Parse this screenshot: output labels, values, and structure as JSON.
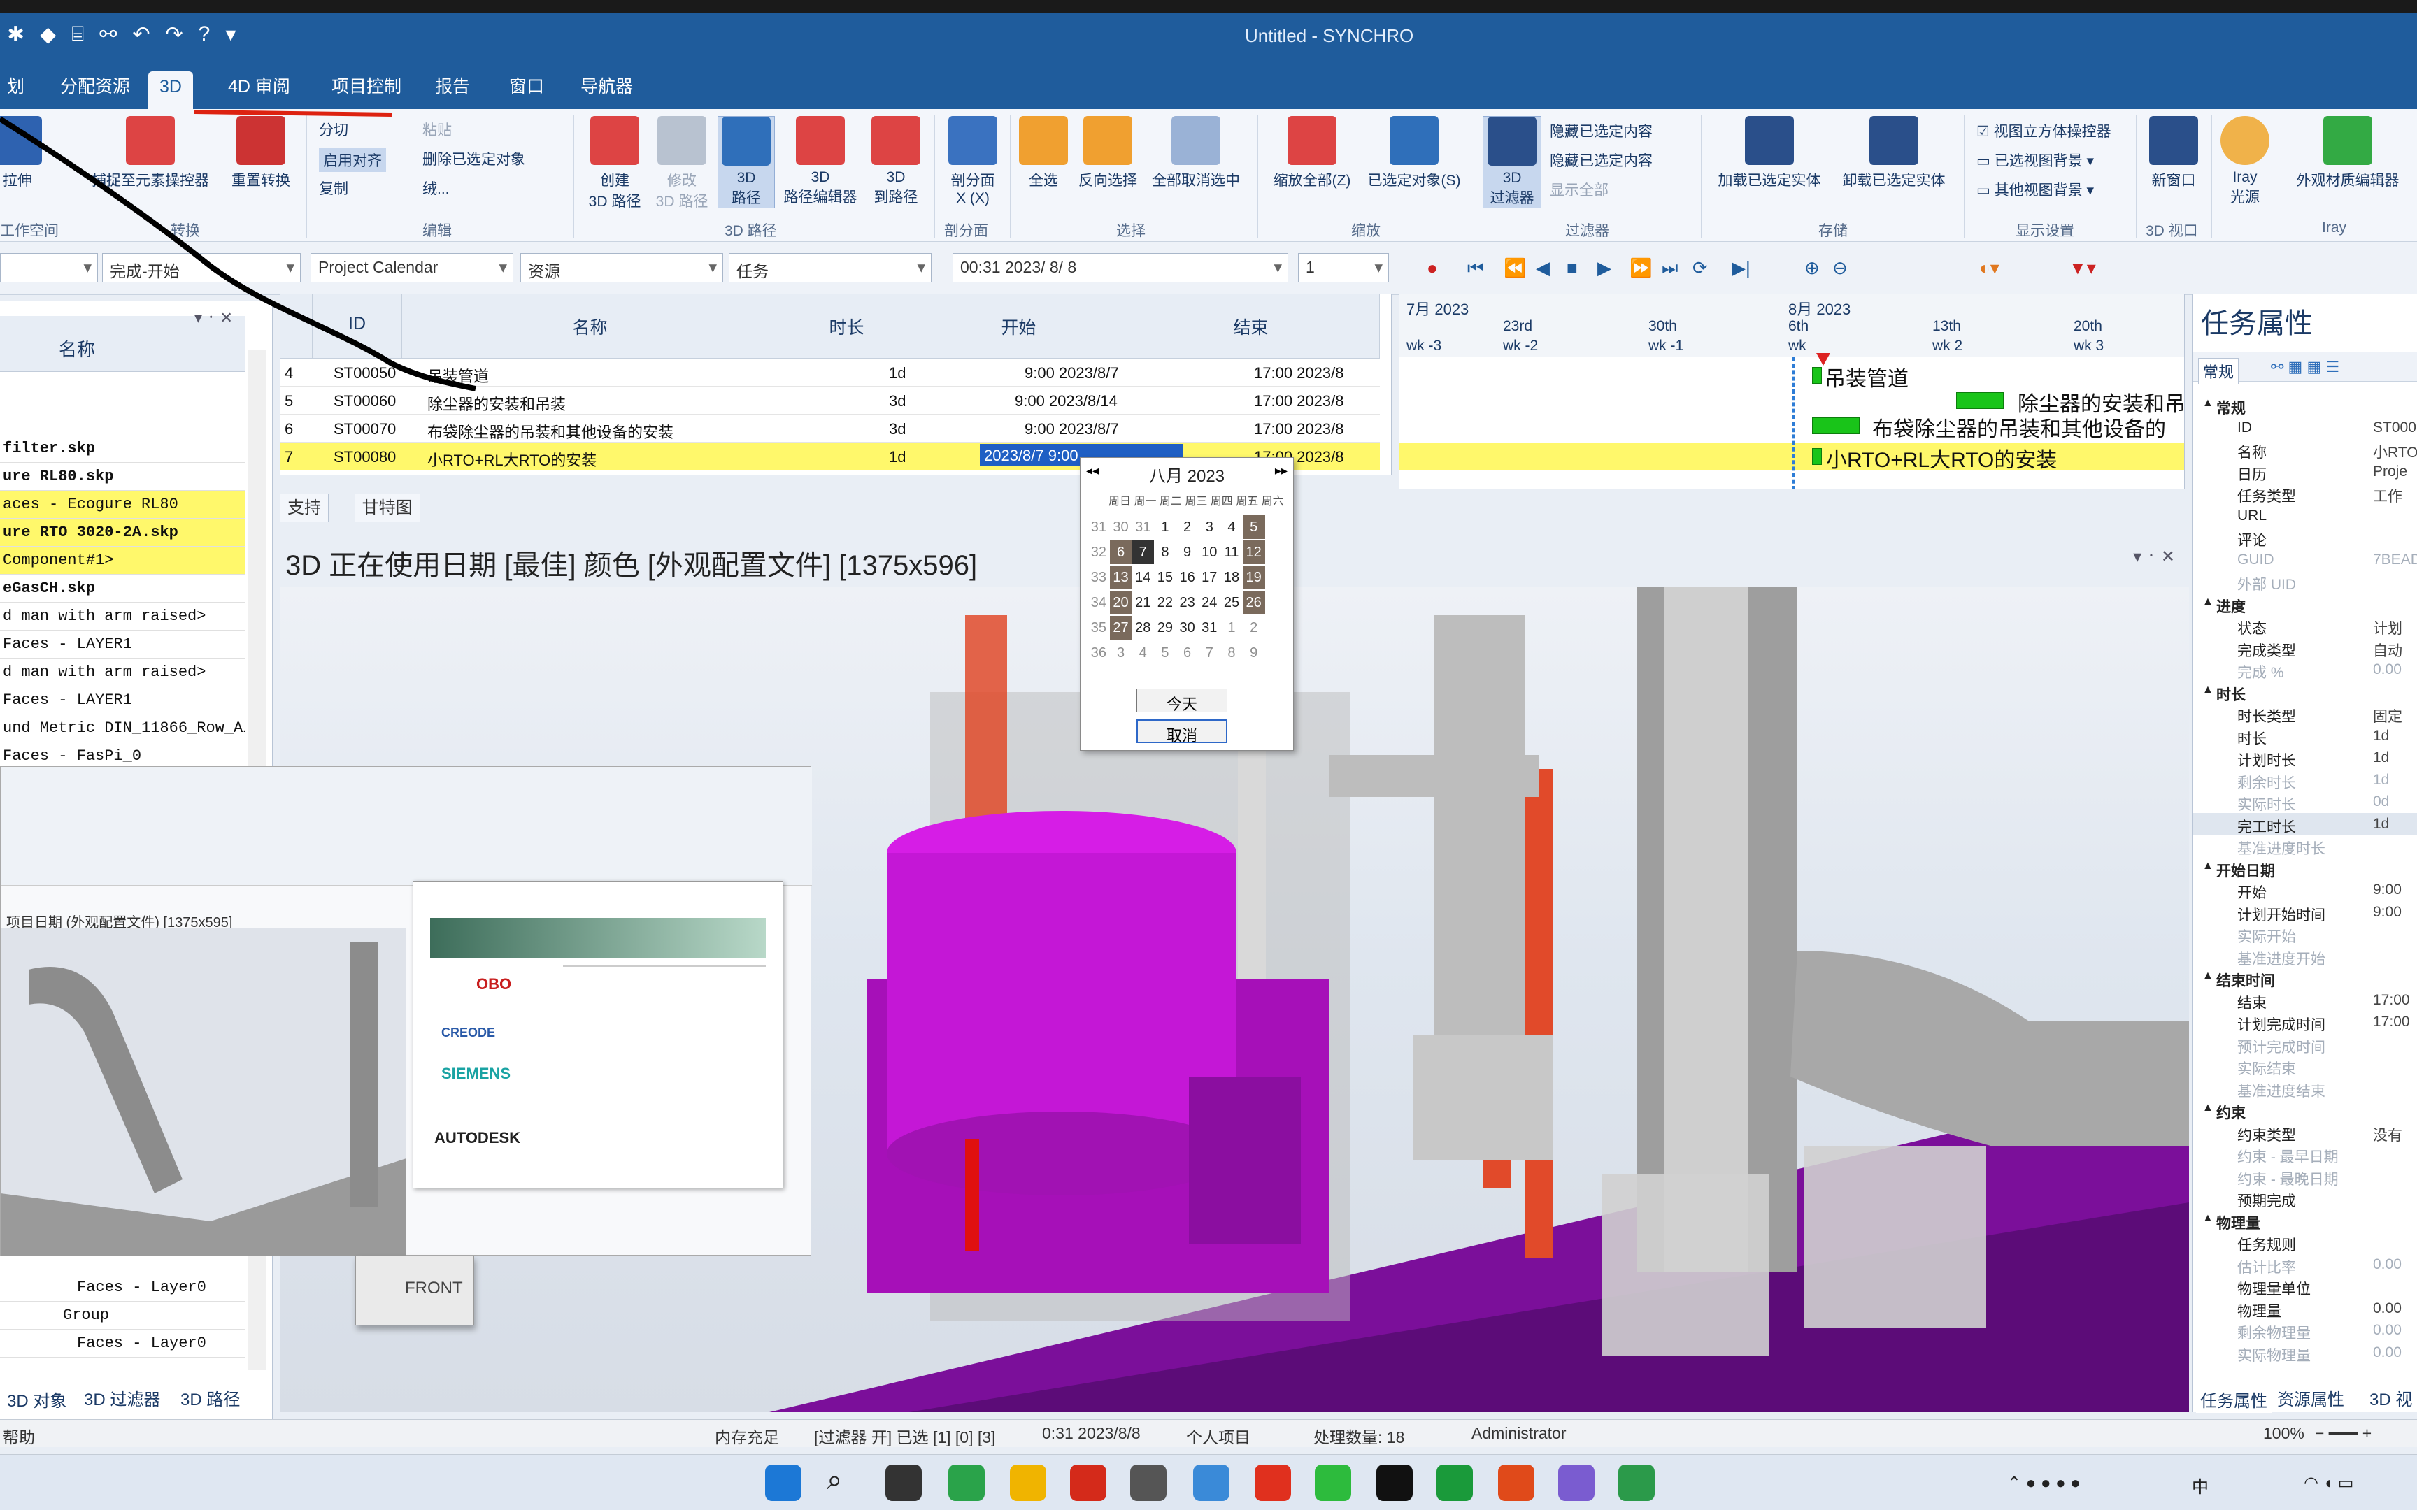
{
  "window": {
    "title": "Untitled - SYNCHRO"
  },
  "menu": {
    "tabs": [
      "划",
      "分配资源",
      "3D",
      "4D 审阅",
      "项目控制",
      "报告",
      "窗口",
      "导航器"
    ]
  },
  "ribbon": {
    "groups": {
      "work_space": "工作空间",
      "transform": "转换",
      "edit": "编辑",
      "path3d": "3D 路径",
      "section": "剖分面",
      "select": "选择",
      "zoom": "缩放",
      "filter": "过滤器",
      "storage": "存储",
      "display": "显示设置",
      "view3d": "3D 视口",
      "iray": "Iray"
    },
    "buttons": {
      "stretch": "拉伸",
      "capture_element": "捕捉至元素操控器",
      "reset_transform": "重置转换",
      "split": "分切",
      "enable_align": "启用对齐",
      "copy": "复制",
      "paste": "粘贴",
      "remove_selected": "删除已选定对象",
      "more": "绒...",
      "create_path": "创建\n3D 路径",
      "modify_path": "修改\n3D 路径",
      "path_3d": "3D\n路径",
      "path_editor": "3D\n路径编辑器",
      "path_to": "3D\n到路径",
      "section_plane": "剖分面\nX (X)",
      "select_all": "全选",
      "invert_select": "反向选择",
      "deselect_all": "全部取消选中",
      "zoom_all": "缩放全部(Z)",
      "zoom_selected": "已选定对象(S)",
      "filter_3d": "3D\n过滤器",
      "hide_selected": "隐藏已选定内容",
      "hide_unselected": "隐藏已选定内容",
      "show_all": "显示全部",
      "load_selected": "加载已选定实体",
      "unload_selected": "卸载已选定实体",
      "view_cube": "视图立方体操控器",
      "selected_bg": "已选视图背景",
      "other_bg": "其他视图背景",
      "new_window": "新窗口",
      "iray_light": "Iray\n光源",
      "appearance_profile": "外观材质编辑器"
    }
  },
  "toolbar2": {
    "combo1": "",
    "combo2": "完成-开始",
    "combo3": "Project Calendar",
    "combo4": "资源",
    "combo5": "任务",
    "date": "00:31 2023/ 8/ 8",
    "spin": "1"
  },
  "left_panel": {
    "header": "名称",
    "rows": [
      "filter.skp",
      "ure RL80.skp",
      "aces - Ecogure RL80",
      "ure RTO 3020-2A.skp",
      "Component#1>",
      "eGasCH.skp",
      "d man with arm raised>",
      "Faces - LAYER1",
      "d man with arm raised>",
      "Faces - LAYER1",
      "und Metric DIN_11866_Row_A/C",
      "Faces - FasPi_0"
    ],
    "tree_rows": [
      "Faces - Layer0",
      "Group",
      "Faces - Layer0"
    ],
    "bottom_tabs": [
      "3D 对象",
      "3D 过滤器",
      "3D 路径"
    ]
  },
  "grid": {
    "headers": {
      "id": "ID",
      "name": "名称",
      "duration": "时长",
      "start": "开始",
      "finish": "结束"
    },
    "rows": [
      {
        "n": "4",
        "id": "ST00050",
        "name": "吊装管道",
        "duration": "1d",
        "start": "9:00 2023/8/7",
        "finish": "17:00 2023/8"
      },
      {
        "n": "5",
        "id": "ST00060",
        "name": "除尘器的安装和吊装",
        "duration": "3d",
        "start": "9:00 2023/8/14",
        "finish": "17:00 2023/8"
      },
      {
        "n": "6",
        "id": "ST00070",
        "name": "布袋除尘器的吊装和其他设备的安装",
        "duration": "3d",
        "start": "9:00 2023/8/7",
        "finish": "17:00 2023/8"
      },
      {
        "n": "7",
        "id": "ST00080",
        "name": "小RTO+RL大RTO的安装",
        "duration": "1d",
        "start": "2023/8/7  9:00",
        "finish": "17:00 2023/8"
      }
    ],
    "tabs": [
      "支持",
      "甘特图"
    ]
  },
  "gantt": {
    "months": [
      "7月 2023",
      "8月 2023"
    ],
    "days": [
      "23rd",
      "30th",
      "6th",
      "13th",
      "20th"
    ],
    "weeks": [
      "wk -3",
      "wk -2",
      "wk -1",
      "wk",
      "wk 2",
      "wk 3"
    ],
    "labels": [
      "吊装管道",
      "除尘器的安装和吊",
      "布袋除尘器的吊装和其他设备的",
      "小RTO+RL大RTO的安装"
    ]
  },
  "calendar": {
    "title": "八月 2023",
    "weekday_header": "周日 周一 周二 周三 周四 周五 周六",
    "weeks": [
      {
        "wk": "31",
        "days": [
          "30",
          "31",
          "1",
          "2",
          "3",
          "4",
          "5"
        ]
      },
      {
        "wk": "32",
        "days": [
          "6",
          "7",
          "8",
          "9",
          "10",
          "11",
          "12"
        ]
      },
      {
        "wk": "33",
        "days": [
          "13",
          "14",
          "15",
          "16",
          "17",
          "18",
          "19"
        ]
      },
      {
        "wk": "34",
        "days": [
          "20",
          "21",
          "22",
          "23",
          "24",
          "25",
          "26"
        ]
      },
      {
        "wk": "35",
        "days": [
          "27",
          "28",
          "29",
          "30",
          "31",
          "1",
          "2"
        ]
      },
      {
        "wk": "36",
        "days": [
          "3",
          "4",
          "5",
          "6",
          "7",
          "8",
          "9"
        ]
      }
    ],
    "today": "今天",
    "cancel": "取消"
  },
  "view3d": {
    "header": "3D 正在使用日期 [最佳] 颜色 [外观配置文件]  [1375x596]",
    "cube_label": "FRONT",
    "brands": [
      "OBO",
      "CREODE",
      "SIEMENS",
      "AUTODESK"
    ],
    "overlay_title": "项目日期 (外观配置文件) [1375x595]"
  },
  "right_panel": {
    "title": "任务属性",
    "tab": "常规",
    "rows": [
      {
        "t": "cat",
        "k": "常规",
        "v": ""
      },
      {
        "t": "",
        "k": "ID",
        "v": "ST000"
      },
      {
        "t": "",
        "k": "名称",
        "v": "小RTO"
      },
      {
        "t": "",
        "k": "日历",
        "v": "Proje"
      },
      {
        "t": "",
        "k": "任务类型",
        "v": "工作"
      },
      {
        "t": "",
        "k": "URL",
        "v": ""
      },
      {
        "t": "",
        "k": "评论",
        "v": ""
      },
      {
        "t": "dim",
        "k": "GUID",
        "v": "7BEAD"
      },
      {
        "t": "dim",
        "k": "外部 UID",
        "v": ""
      },
      {
        "t": "cat",
        "k": "进度",
        "v": ""
      },
      {
        "t": "",
        "k": "状态",
        "v": "计划"
      },
      {
        "t": "",
        "k": "完成类型",
        "v": "自动"
      },
      {
        "t": "dim",
        "k": "完成 %",
        "v": "0.00"
      },
      {
        "t": "cat",
        "k": "时长",
        "v": ""
      },
      {
        "t": "",
        "k": "时长类型",
        "v": "固定"
      },
      {
        "t": "",
        "k": "时长",
        "v": "1d"
      },
      {
        "t": "",
        "k": "计划时长",
        "v": "1d"
      },
      {
        "t": "dim",
        "k": "剩余时长",
        "v": "1d"
      },
      {
        "t": "dim",
        "k": "实际时长",
        "v": "0d"
      },
      {
        "t": "hl",
        "k": "完工时长",
        "v": "1d"
      },
      {
        "t": "dim",
        "k": "基准进度时长",
        "v": ""
      },
      {
        "t": "cat",
        "k": "开始日期",
        "v": ""
      },
      {
        "t": "",
        "k": "开始",
        "v": "9:00"
      },
      {
        "t": "",
        "k": "计划开始时间",
        "v": "9:00"
      },
      {
        "t": "dim",
        "k": "实际开始",
        "v": ""
      },
      {
        "t": "dim",
        "k": "基准进度开始",
        "v": ""
      },
      {
        "t": "cat",
        "k": "结束时间",
        "v": ""
      },
      {
        "t": "",
        "k": "结束",
        "v": "17:00"
      },
      {
        "t": "",
        "k": "计划完成时间",
        "v": "17:00"
      },
      {
        "t": "dim",
        "k": "预计完成时间",
        "v": ""
      },
      {
        "t": "dim",
        "k": "实际结束",
        "v": ""
      },
      {
        "t": "dim",
        "k": "基准进度结束",
        "v": ""
      },
      {
        "t": "cat",
        "k": "约束",
        "v": ""
      },
      {
        "t": "",
        "k": "约束类型",
        "v": "没有"
      },
      {
        "t": "dim",
        "k": "约束 - 最早日期",
        "v": ""
      },
      {
        "t": "dim",
        "k": "约束 - 最晚日期",
        "v": ""
      },
      {
        "t": "",
        "k": "预期完成",
        "v": ""
      },
      {
        "t": "cat",
        "k": "物理量",
        "v": ""
      },
      {
        "t": "",
        "k": "任务规则",
        "v": ""
      },
      {
        "t": "dim",
        "k": "估计比率",
        "v": "0.00"
      },
      {
        "t": "",
        "k": "物理量单位",
        "v": ""
      },
      {
        "t": "",
        "k": "物理量",
        "v": "0.00"
      },
      {
        "t": "dim",
        "k": "剩余物理量",
        "v": "0.00"
      },
      {
        "t": "dim",
        "k": "实际物理量",
        "v": "0.00"
      }
    ],
    "bottom_tabs": [
      "任务属性",
      "资源属性",
      "3D 视"
    ]
  },
  "status": {
    "help": "帮助",
    "memory": "内存充足",
    "filter": "[过滤器 开] 已选 [1] [0] [3]",
    "datetime": "0:31 2023/8/8",
    "project": "个人项目",
    "count": "处理数量: 18",
    "user": "Administrator",
    "zoom": "100%"
  },
  "taskbar": {
    "ime": "中"
  }
}
